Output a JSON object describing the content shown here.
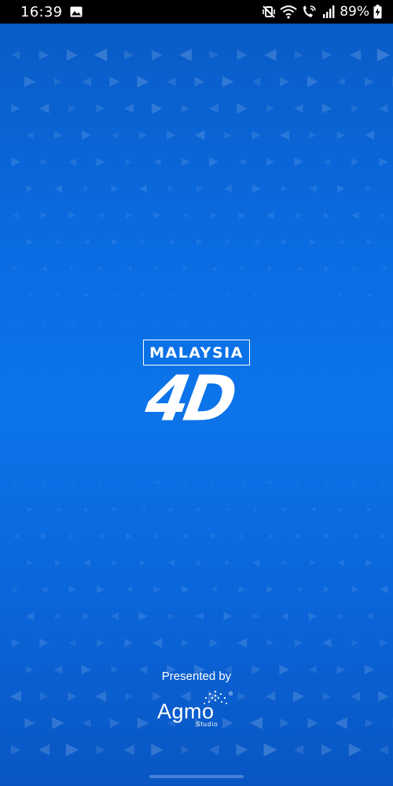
{
  "status_bar": {
    "time": "16:39",
    "battery_percent": "89%",
    "icons": [
      "image-icon",
      "vibrate-mute-icon",
      "wifi-icon",
      "wifi-calling-icon",
      "signal-icon",
      "battery-icon"
    ]
  },
  "splash": {
    "logo_country": "MALAYSIA",
    "logo_mark": "4D",
    "presented_by": "Presented by",
    "company_name": "Agmo",
    "company_sub": "Studio",
    "registered_mark": "®"
  },
  "colors": {
    "background_top": "#0a5cc7",
    "background_mid": "#0c74ea",
    "background_bottom": "#0956c3",
    "text": "#ffffff",
    "status_bar": "#000000"
  }
}
